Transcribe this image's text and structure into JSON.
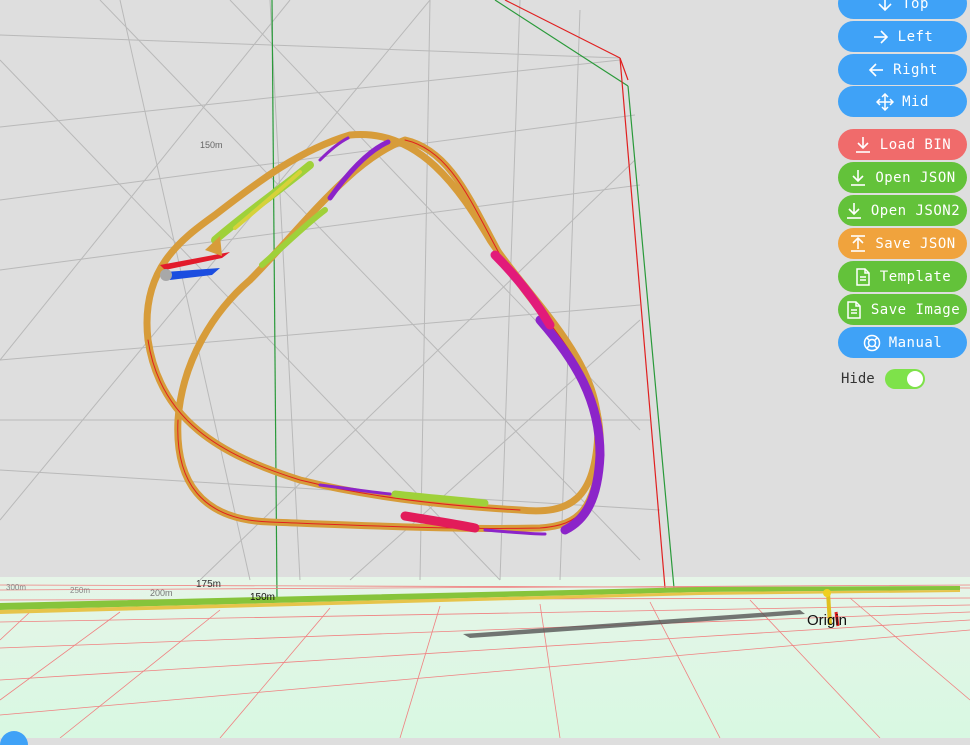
{
  "toolbar": {
    "buttons": [
      {
        "label": "Top",
        "icon": "arrow-down-icon",
        "color": "#3fa2f7"
      },
      {
        "label": "Left",
        "icon": "arrow-right-icon",
        "color": "#3fa2f7"
      },
      {
        "label": "Right",
        "icon": "arrow-left-icon",
        "color": "#3fa2f7"
      },
      {
        "label": "Mid",
        "icon": "move-icon",
        "color": "#3fa2f7"
      },
      {
        "label": "Load BIN",
        "icon": "download-icon",
        "color": "#f06b6b"
      },
      {
        "label": "Open JSON",
        "icon": "download-icon",
        "color": "#63c23a"
      },
      {
        "label": "Open JSON2",
        "icon": "download-icon",
        "color": "#63c23a"
      },
      {
        "label": "Save JSON",
        "icon": "upload-icon",
        "color": "#f0a33d"
      },
      {
        "label": "Template",
        "icon": "document-icon",
        "color": "#63c23a"
      },
      {
        "label": "Save Image",
        "icon": "document-icon",
        "color": "#63c23a"
      },
      {
        "label": "Manual",
        "icon": "lifebuoy-icon",
        "color": "#3fa2f7"
      }
    ],
    "hide_label": "Hide",
    "hide_on": true
  },
  "scene": {
    "wall_labels": {
      "m150": "150m"
    },
    "ground_labels": {
      "m300": "300m",
      "m250": "250m",
      "m200": "200m",
      "m175": "175m",
      "m150": "150m"
    },
    "origin_label": "Origin"
  }
}
